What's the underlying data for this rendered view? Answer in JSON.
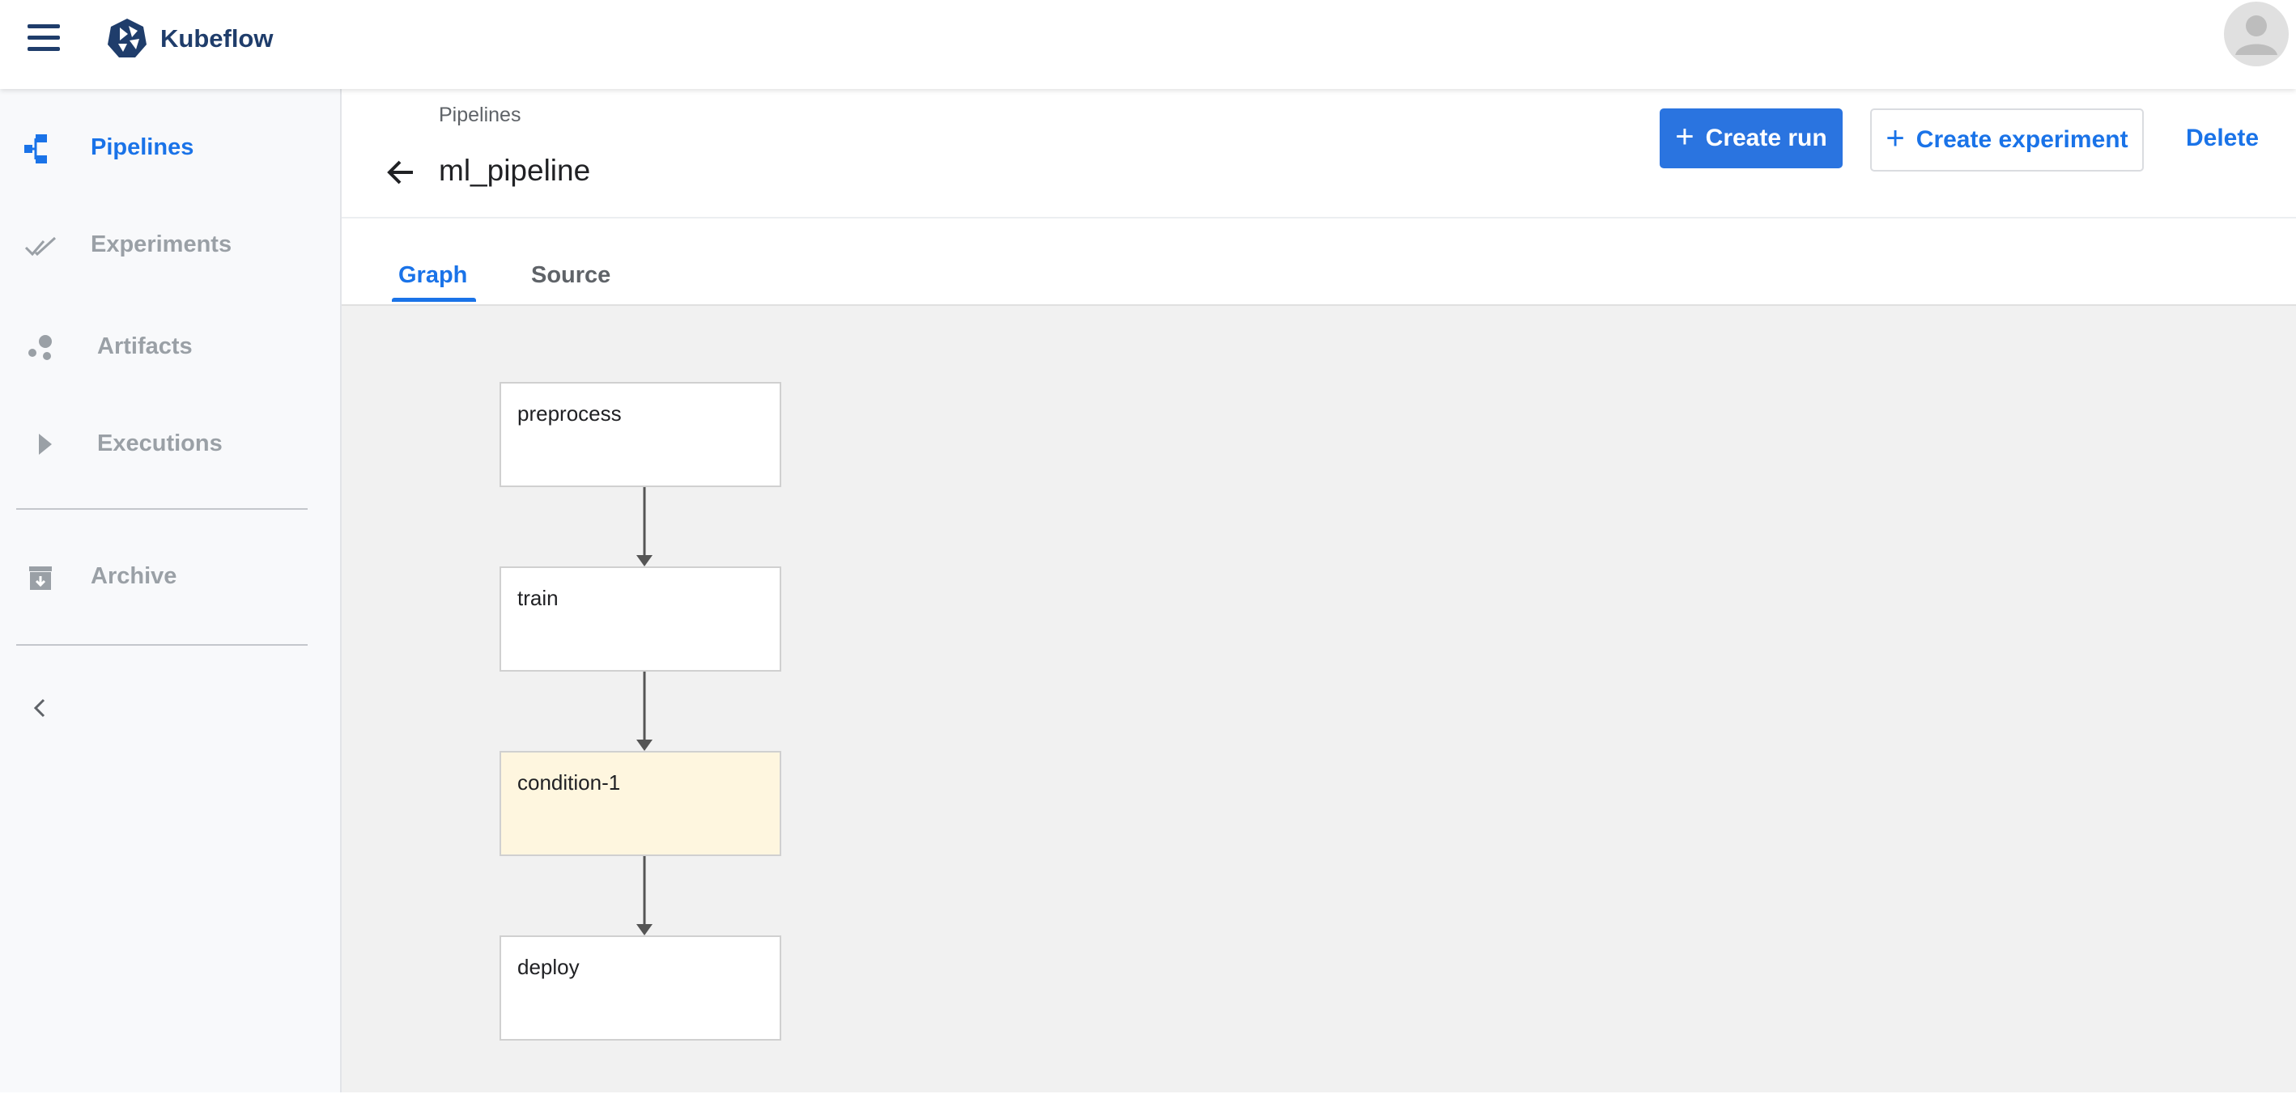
{
  "app": {
    "brand": "Kubeflow"
  },
  "colors": {
    "accent": "#1a73e8",
    "primary_button": "#2a74e0",
    "brand": "#1f3d6b",
    "condition_node": "#fef6df",
    "canvas": "#f1f1f1"
  },
  "sidebar": {
    "items": [
      {
        "label": "Pipelines",
        "icon": "pipelines-icon",
        "active": true
      },
      {
        "label": "Experiments",
        "icon": "experiments-icon",
        "active": false
      },
      {
        "label": "Artifacts",
        "icon": "artifacts-icon",
        "active": false
      },
      {
        "label": "Executions",
        "icon": "executions-icon",
        "active": false
      },
      {
        "label": "Archive",
        "icon": "archive-icon",
        "active": false
      }
    ]
  },
  "header": {
    "breadcrumb": "Pipelines",
    "title": "ml_pipeline",
    "create_run_label": "Create run",
    "create_experiment_label": "Create experiment",
    "delete_label": "Delete"
  },
  "tabs": [
    {
      "label": "Graph",
      "active": true
    },
    {
      "label": "Source",
      "active": false
    }
  ],
  "graph": {
    "nodes": [
      {
        "label": "preprocess",
        "type": "task"
      },
      {
        "label": "train",
        "type": "task"
      },
      {
        "label": "condition-1",
        "type": "condition"
      },
      {
        "label": "deploy",
        "type": "task"
      }
    ]
  }
}
